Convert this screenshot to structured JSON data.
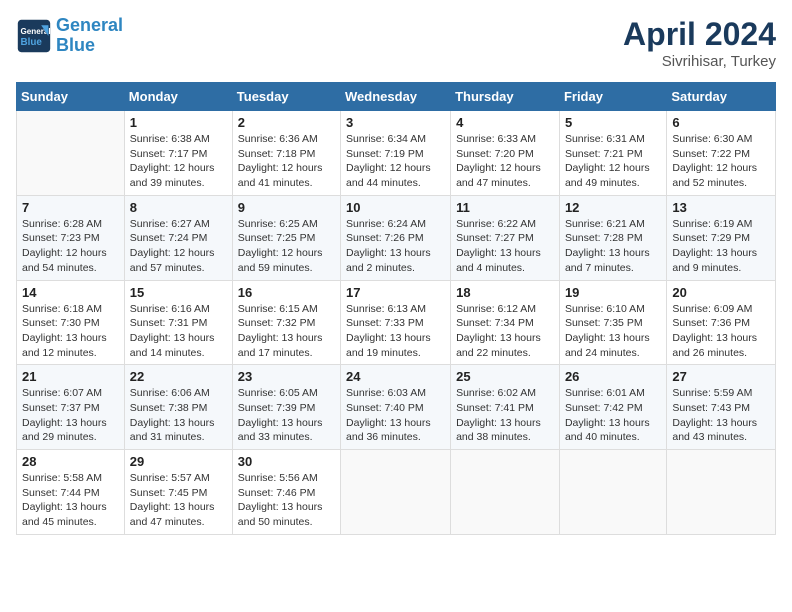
{
  "header": {
    "logo_line1": "General",
    "logo_line2": "Blue",
    "month_year": "April 2024",
    "location": "Sivrihisar, Turkey"
  },
  "weekdays": [
    "Sunday",
    "Monday",
    "Tuesday",
    "Wednesday",
    "Thursday",
    "Friday",
    "Saturday"
  ],
  "weeks": [
    [
      {
        "day": "",
        "info": ""
      },
      {
        "day": "1",
        "info": "Sunrise: 6:38 AM\nSunset: 7:17 PM\nDaylight: 12 hours\nand 39 minutes."
      },
      {
        "day": "2",
        "info": "Sunrise: 6:36 AM\nSunset: 7:18 PM\nDaylight: 12 hours\nand 41 minutes."
      },
      {
        "day": "3",
        "info": "Sunrise: 6:34 AM\nSunset: 7:19 PM\nDaylight: 12 hours\nand 44 minutes."
      },
      {
        "day": "4",
        "info": "Sunrise: 6:33 AM\nSunset: 7:20 PM\nDaylight: 12 hours\nand 47 minutes."
      },
      {
        "day": "5",
        "info": "Sunrise: 6:31 AM\nSunset: 7:21 PM\nDaylight: 12 hours\nand 49 minutes."
      },
      {
        "day": "6",
        "info": "Sunrise: 6:30 AM\nSunset: 7:22 PM\nDaylight: 12 hours\nand 52 minutes."
      }
    ],
    [
      {
        "day": "7",
        "info": "Sunrise: 6:28 AM\nSunset: 7:23 PM\nDaylight: 12 hours\nand 54 minutes."
      },
      {
        "day": "8",
        "info": "Sunrise: 6:27 AM\nSunset: 7:24 PM\nDaylight: 12 hours\nand 57 minutes."
      },
      {
        "day": "9",
        "info": "Sunrise: 6:25 AM\nSunset: 7:25 PM\nDaylight: 12 hours\nand 59 minutes."
      },
      {
        "day": "10",
        "info": "Sunrise: 6:24 AM\nSunset: 7:26 PM\nDaylight: 13 hours\nand 2 minutes."
      },
      {
        "day": "11",
        "info": "Sunrise: 6:22 AM\nSunset: 7:27 PM\nDaylight: 13 hours\nand 4 minutes."
      },
      {
        "day": "12",
        "info": "Sunrise: 6:21 AM\nSunset: 7:28 PM\nDaylight: 13 hours\nand 7 minutes."
      },
      {
        "day": "13",
        "info": "Sunrise: 6:19 AM\nSunset: 7:29 PM\nDaylight: 13 hours\nand 9 minutes."
      }
    ],
    [
      {
        "day": "14",
        "info": "Sunrise: 6:18 AM\nSunset: 7:30 PM\nDaylight: 13 hours\nand 12 minutes."
      },
      {
        "day": "15",
        "info": "Sunrise: 6:16 AM\nSunset: 7:31 PM\nDaylight: 13 hours\nand 14 minutes."
      },
      {
        "day": "16",
        "info": "Sunrise: 6:15 AM\nSunset: 7:32 PM\nDaylight: 13 hours\nand 17 minutes."
      },
      {
        "day": "17",
        "info": "Sunrise: 6:13 AM\nSunset: 7:33 PM\nDaylight: 13 hours\nand 19 minutes."
      },
      {
        "day": "18",
        "info": "Sunrise: 6:12 AM\nSunset: 7:34 PM\nDaylight: 13 hours\nand 22 minutes."
      },
      {
        "day": "19",
        "info": "Sunrise: 6:10 AM\nSunset: 7:35 PM\nDaylight: 13 hours\nand 24 minutes."
      },
      {
        "day": "20",
        "info": "Sunrise: 6:09 AM\nSunset: 7:36 PM\nDaylight: 13 hours\nand 26 minutes."
      }
    ],
    [
      {
        "day": "21",
        "info": "Sunrise: 6:07 AM\nSunset: 7:37 PM\nDaylight: 13 hours\nand 29 minutes."
      },
      {
        "day": "22",
        "info": "Sunrise: 6:06 AM\nSunset: 7:38 PM\nDaylight: 13 hours\nand 31 minutes."
      },
      {
        "day": "23",
        "info": "Sunrise: 6:05 AM\nSunset: 7:39 PM\nDaylight: 13 hours\nand 33 minutes."
      },
      {
        "day": "24",
        "info": "Sunrise: 6:03 AM\nSunset: 7:40 PM\nDaylight: 13 hours\nand 36 minutes."
      },
      {
        "day": "25",
        "info": "Sunrise: 6:02 AM\nSunset: 7:41 PM\nDaylight: 13 hours\nand 38 minutes."
      },
      {
        "day": "26",
        "info": "Sunrise: 6:01 AM\nSunset: 7:42 PM\nDaylight: 13 hours\nand 40 minutes."
      },
      {
        "day": "27",
        "info": "Sunrise: 5:59 AM\nSunset: 7:43 PM\nDaylight: 13 hours\nand 43 minutes."
      }
    ],
    [
      {
        "day": "28",
        "info": "Sunrise: 5:58 AM\nSunset: 7:44 PM\nDaylight: 13 hours\nand 45 minutes."
      },
      {
        "day": "29",
        "info": "Sunrise: 5:57 AM\nSunset: 7:45 PM\nDaylight: 13 hours\nand 47 minutes."
      },
      {
        "day": "30",
        "info": "Sunrise: 5:56 AM\nSunset: 7:46 PM\nDaylight: 13 hours\nand 50 minutes."
      },
      {
        "day": "",
        "info": ""
      },
      {
        "day": "",
        "info": ""
      },
      {
        "day": "",
        "info": ""
      },
      {
        "day": "",
        "info": ""
      }
    ]
  ]
}
